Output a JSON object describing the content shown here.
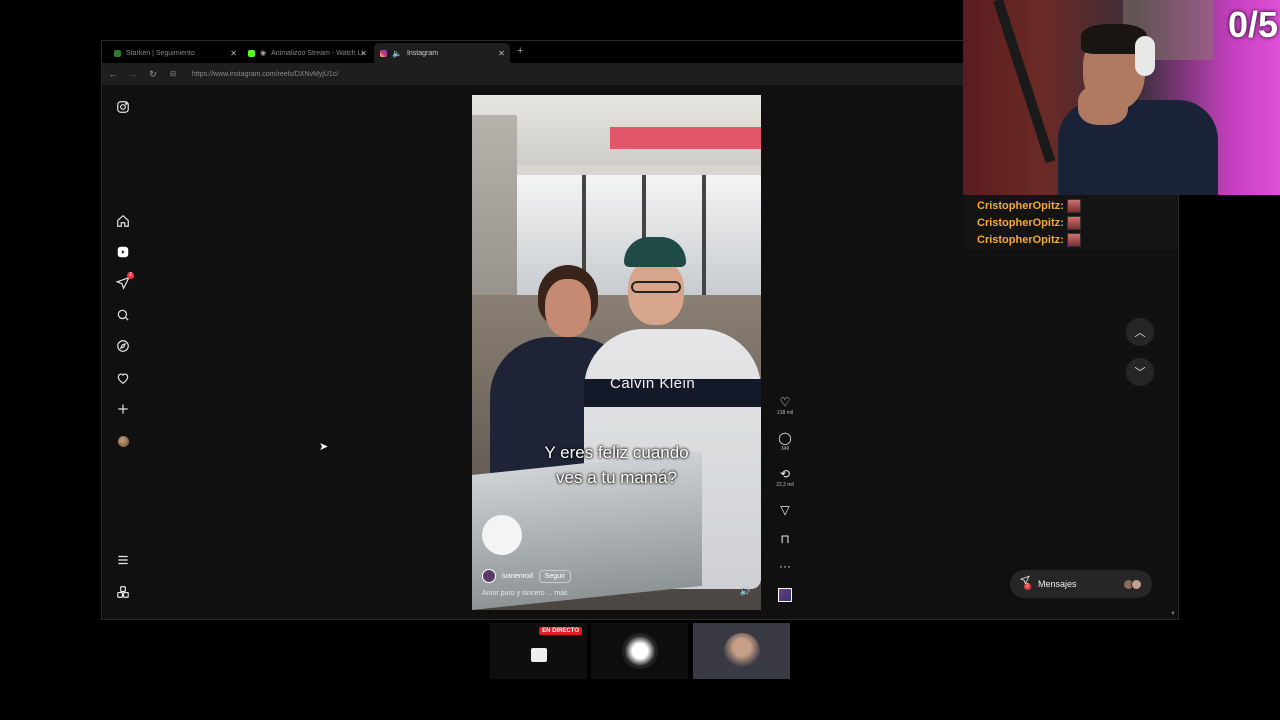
{
  "browser": {
    "tabs": [
      {
        "label": "Starken | Seguimiento",
        "favicon_color": "#2e7d32",
        "active": false
      },
      {
        "label": "Animalizoo Stream - Watch Li",
        "favicon_color": "#53fc18",
        "active": false
      },
      {
        "label": "Instagram",
        "favicon_color": "#e1306c",
        "active": true
      }
    ],
    "new_tab": "+",
    "url": "https://www.instagram.com/reels/DXNvMyjU1c/"
  },
  "sidebar": {
    "items": [
      "instagram-logo",
      "home",
      "reels",
      "direct",
      "search",
      "explore",
      "notifications",
      "create",
      "profile",
      "more",
      "meta"
    ],
    "direct_badge": "2"
  },
  "reel": {
    "caption_line1": "Y eres feliz cuando",
    "caption_line2": "ves a tu mamá?",
    "shirt_brand": "Calvin Klein",
    "author": "ivanenrod",
    "follow_label": "Seguir",
    "description": "Amor puro y sincero",
    "more_label": "... más",
    "sound_icon": "🔊"
  },
  "actions": {
    "likes": "218 mil",
    "comments": "349",
    "reposts": "22,2 mil"
  },
  "messages": {
    "label": "Mensajes",
    "badge": "2"
  },
  "stream": {
    "counter": "0/5",
    "chat": [
      {
        "user": "CristopherOpitz:"
      },
      {
        "user": "CristopherOpitz:"
      },
      {
        "user": "CristopherOpitz:"
      }
    ]
  },
  "thumbnails": {
    "live_label": "EN DIRECTO"
  },
  "colors": {
    "accent_red": "#ff3040",
    "chat_user": "#f3a93a",
    "live_red": "#e31b23"
  }
}
